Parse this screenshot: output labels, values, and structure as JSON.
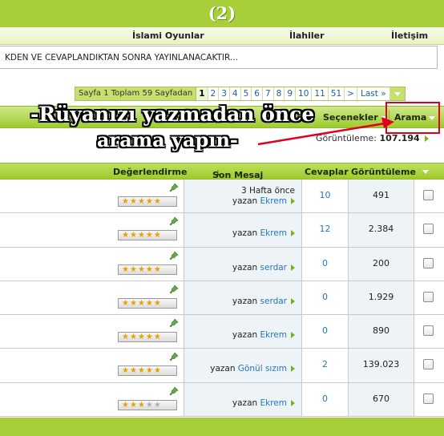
{
  "header": {
    "badge": "(2)"
  },
  "nav": {
    "items": [
      "İslami Oyunlar",
      "İlahiler",
      "İletişim"
    ]
  },
  "notice": "KDEN VE CEVAPLANDIKTAN SONRA YAYINLANACAKTIR...",
  "pager": {
    "info": "Sayfa 1 Toplam 59 Sayfadan",
    "pages": [
      "1",
      "2",
      "3",
      "4",
      "5",
      "6",
      "7",
      "8",
      "9",
      "10",
      "11",
      "51",
      ">"
    ],
    "current": "1",
    "last": "Last »"
  },
  "toolbar": {
    "options": "Seçenekler",
    "search": "Arama"
  },
  "overlay": {
    "line1": "-Rüyanızı yazmadan önce",
    "line2": "arama yapın-"
  },
  "views": {
    "label": "Görüntüleme:",
    "value": "107.194"
  },
  "table": {
    "headers": {
      "rating": "Değerlendirme",
      "last_post": "Son Mesaj",
      "replies": "Cevaplar",
      "views": "Görüntüleme"
    },
    "rows": [
      {
        "stars": 5,
        "time": "3 Hafta önce",
        "by": "yazan",
        "user": "Ekrem",
        "replies": "10",
        "views": "491"
      },
      {
        "stars": 5,
        "time": "",
        "by": "yazan",
        "user": "Ekrem",
        "replies": "12",
        "views": "2.384"
      },
      {
        "stars": 5,
        "time": "",
        "by": "yazan",
        "user": "serdar",
        "replies": "0",
        "views": "200"
      },
      {
        "stars": 5,
        "time": "",
        "by": "yazan",
        "user": "serdar",
        "replies": "0",
        "views": "1.929"
      },
      {
        "stars": 5,
        "time": "",
        "by": "yazan",
        "user": "Ekrem",
        "replies": "0",
        "views": "890"
      },
      {
        "stars": 5,
        "time": "",
        "by": "yazan",
        "user": "Gönül sızım",
        "replies": "2",
        "views": "139.023"
      },
      {
        "stars": 3,
        "time": "",
        "by": "yazan",
        "user": "Ekrem",
        "replies": "0",
        "views": "670"
      }
    ]
  },
  "colors": {
    "green": "#a7cf3a",
    "link": "#2179b5",
    "annotation_red": "#e0001b"
  }
}
